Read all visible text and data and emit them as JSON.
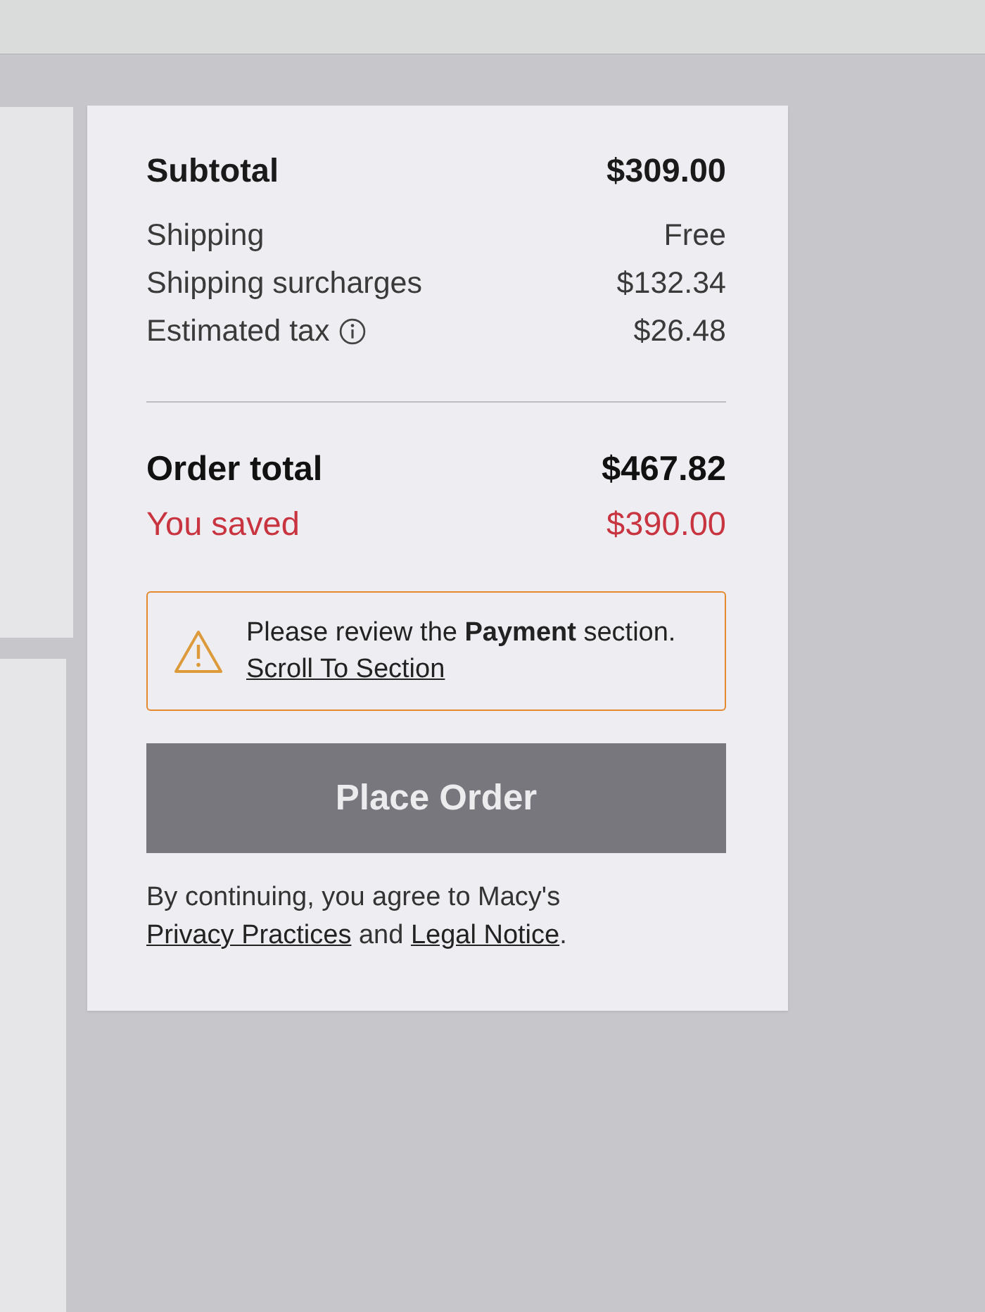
{
  "summary": {
    "subtotal": {
      "label": "Subtotal",
      "value": "$309.00"
    },
    "lines": [
      {
        "label": "Shipping",
        "value": "Free",
        "info": false
      },
      {
        "label": "Shipping surcharges",
        "value": "$132.34",
        "info": false
      },
      {
        "label": "Estimated tax",
        "value": "$26.48",
        "info": true
      }
    ],
    "total": {
      "label": "Order total",
      "value": "$467.82"
    },
    "savings": {
      "label": "You saved",
      "value": "$390.00"
    }
  },
  "alert": {
    "message": "Please review the **Payment** section.",
    "link": "Scroll To Section"
  },
  "place_order_button": {
    "label": "Place Order",
    "disabled": true
  },
  "legal": {
    "parts": [
      {
        "kind": "text",
        "text": "By continuing, you agree to Macy's "
      },
      {
        "kind": "link",
        "text": "Privacy Practices"
      },
      {
        "kind": "text",
        "text": " and "
      },
      {
        "kind": "link",
        "text": "Legal Notice"
      },
      {
        "kind": "text",
        "text": "."
      }
    ]
  }
}
